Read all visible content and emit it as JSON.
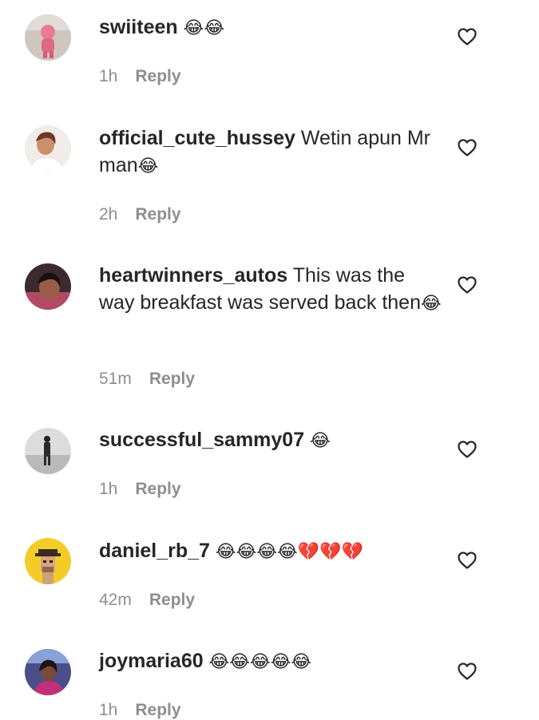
{
  "comments": [
    {
      "username": "swiiteen",
      "text": "",
      "emoji": "😂😂",
      "time": "1h",
      "reply_label": "Reply"
    },
    {
      "username": "official_cute_hussey",
      "text": "Wetin apun Mr man",
      "emoji": "😂",
      "time": "2h",
      "reply_label": "Reply"
    },
    {
      "username": "heartwinners_autos",
      "text": "This was the way breakfast was served back then",
      "emoji": "😂",
      "time": "51m",
      "reply_label": "Reply"
    },
    {
      "username": "successful_sammy07",
      "text": "",
      "emoji": "😂",
      "time": "1h",
      "reply_label": "Reply"
    },
    {
      "username": "daniel_rb_7",
      "text": "",
      "emoji": "😂😂😂😂💔💔💔",
      "time": "42m",
      "reply_label": "Reply"
    },
    {
      "username": "joymaria60",
      "text": "",
      "emoji": "😂😂😂😂😂",
      "time": "1h",
      "reply_label": "Reply"
    }
  ],
  "icons": {
    "like": "heart-outline-icon",
    "avatar": "user-avatar"
  },
  "colors": {
    "text": "#262626",
    "meta": "#8e8e8e",
    "background": "#ffffff"
  }
}
